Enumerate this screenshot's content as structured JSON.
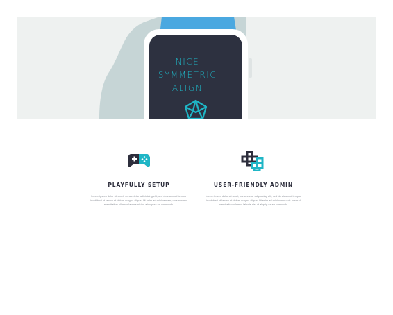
{
  "colors": {
    "hero_background": "#eef1f0",
    "hill": "#c6d5d6",
    "watch_strap": "#4aa8e0",
    "watch_screen": "#2d3140",
    "accent": "#1fb6c6",
    "dark": "#2d2e3c"
  },
  "hero": {
    "screen_lines": [
      "NICE",
      "SYMMETRIC",
      "ALIGN"
    ],
    "screen_icon": "pentagon-gem-icon"
  },
  "features": [
    {
      "title": "PLAYFULLY SETUP",
      "icon": "gamepad-icon",
      "body": "Lorem ipsum dolor sit amet, consectetur adipisicing elit, sed do eiusmod tempor incididunt ut labore et dolore magna aliqua. Ut enim ad mini veniam, quis nostrud exercitation ullamco laboris nisi ut aliquip ex ea commodo."
    },
    {
      "title": "USER-FRIENDLY ADMIN",
      "icon": "blocks-icon",
      "body": "Lorem ipsum dolor sit amet, consectetur adipisicing elit, sed do eiusmod tempor incididunt ut labore et dolore magna aliqua. Ut enim ad mininveen quis nostrud exercitation ullamco laboris nisi ut aliquip ex ea commodo."
    }
  ]
}
